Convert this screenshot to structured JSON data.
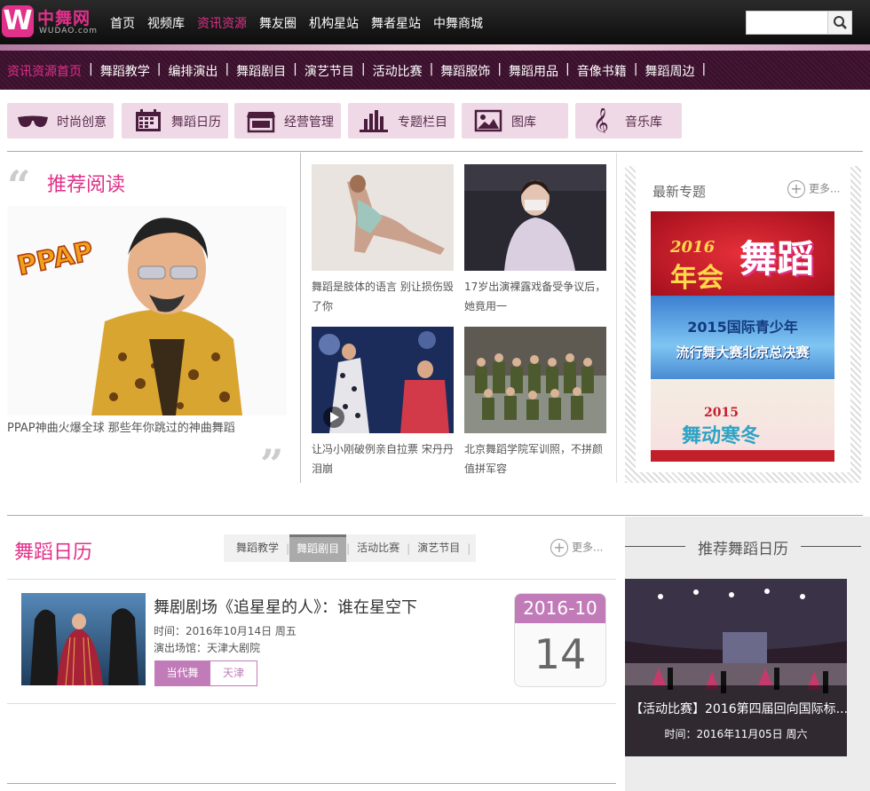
{
  "logo": {
    "cn": "中舞网",
    "en": "WUDAO.com"
  },
  "nav": {
    "items": [
      "首页",
      "视频库",
      "资讯资源",
      "舞友圈",
      "机构星站",
      "舞者星站",
      "中舞商城"
    ]
  },
  "search": {
    "placeholder": ""
  },
  "subnav": {
    "items": [
      "资讯资源首页",
      "舞蹈教学",
      "编排演出",
      "舞蹈剧目",
      "演艺节目",
      "活动比赛",
      "舞蹈服饰",
      "舞蹈用品",
      "音像书籍",
      "舞蹈周边"
    ]
  },
  "pills": [
    {
      "label": "时尚创意",
      "icon": "sunglasses-icon"
    },
    {
      "label": "舞蹈日历",
      "icon": "calendar-icon"
    },
    {
      "label": "经营管理",
      "icon": "shop-icon"
    },
    {
      "label": "专题栏目",
      "icon": "bar-chart-icon"
    },
    {
      "label": "图库",
      "icon": "picture-icon"
    },
    {
      "label": "音乐库",
      "icon": "treble-clef-icon"
    }
  ],
  "recommend": {
    "title": "推荐阅读",
    "main_caption": "PPAP神曲火爆全球 那些年你跳过的神曲舞蹈",
    "ppap_text": "PPAP",
    "items": [
      {
        "caption": "舞蹈是肢体的语言 别让损伤毁了你"
      },
      {
        "caption": "17岁出演裸露戏备受争议后，她竟用一"
      },
      {
        "caption": "让冯小刚破例亲自拉票 宋丹丹泪崩"
      },
      {
        "caption": "北京舞蹈学院军训照，不拼颜值拼军容"
      }
    ]
  },
  "special": {
    "title": "最新专题",
    "more": "更多...",
    "banners": [
      {
        "year": "2016",
        "text": "年会",
        "big": "舞蹈"
      },
      {
        "line1": "2015国际青少年",
        "line2": "流行舞大赛北京总决赛"
      },
      {
        "year": "2015",
        "text": "舞动寒冬"
      }
    ]
  },
  "calendar": {
    "title": "舞蹈日历",
    "tabs": [
      "舞蹈教学",
      "舞蹈剧目",
      "活动比赛",
      "演艺节目"
    ],
    "active_tab": "舞蹈剧目",
    "more": "更多...",
    "event": {
      "title": "舞剧剧场《追星星的人》：谁在星空下",
      "time": "时间：2016年10月14日 周五",
      "venue": "演出场馆：天津大剧院",
      "tags": [
        "当代舞",
        "天津"
      ],
      "ym": "2016-10",
      "day": "14"
    }
  },
  "side_calendar": {
    "title": "推荐舞蹈日历",
    "caption": "【活动比赛】2016第四届回向国际标...",
    "time": "时间：2016年11月05日 周六"
  },
  "colors": {
    "accent": "#e1318a",
    "subnav_bg": "#3a0f2c",
    "pill_bg": "#f0d9e7",
    "date_header": "#c27bb9"
  }
}
